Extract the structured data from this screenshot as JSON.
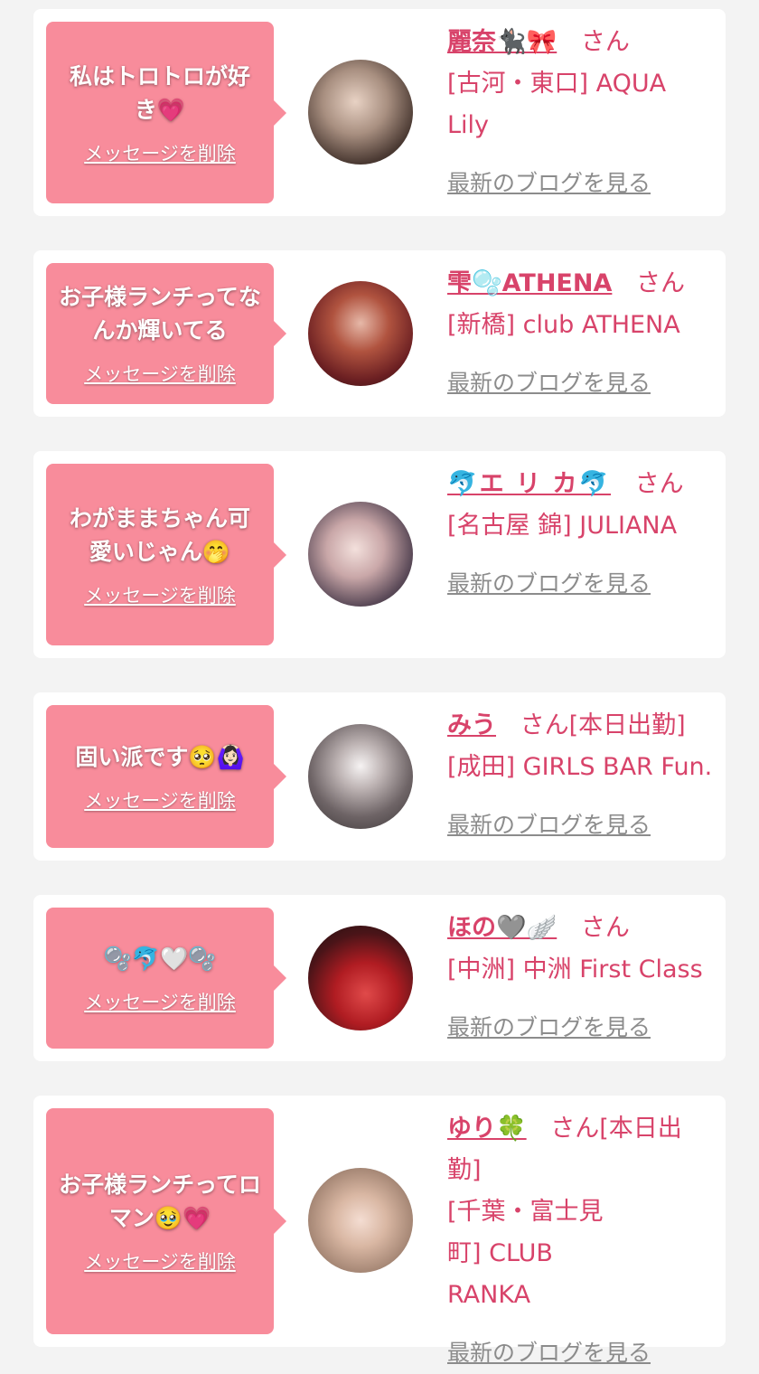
{
  "colors": {
    "page_bg": "#f3f3f3",
    "bubble_bg": "#f88c9b",
    "accent": "#d8436a",
    "muted_link": "#8c8c8c"
  },
  "cards": [
    {
      "message": "私はトロトロが好き💗",
      "delete_label": "メッセージを削除",
      "name": "麗奈🐈‍⬛🎀",
      "suffix": "さん",
      "shop": "[古河・東口] AQUA Lily",
      "blog_label": "最新のブログを見る",
      "avatar_icon": "avatar-photo"
    },
    {
      "message": "お子様ランチってなんか輝いてる",
      "delete_label": "メッセージを削除",
      "name": "雫🫧ATHENA",
      "suffix": "さん",
      "shop": "[新橋] club ATHENA",
      "blog_label": "最新のブログを見る",
      "avatar_icon": "avatar-photo"
    },
    {
      "message": "わがままちゃん可愛いじゃん🤭",
      "delete_label": "メッセージを削除",
      "name": "🐬エ リ カ🐬",
      "suffix": "さん",
      "shop": "[名古屋 錦] JULIANA",
      "blog_label": "最新のブログを見る",
      "avatar_icon": "avatar-photo"
    },
    {
      "message": "固い派です🥺🙆🏻‍♀️",
      "delete_label": "メッセージを削除",
      "name": "みう",
      "suffix": "さん[本日出勤]",
      "shop": "[成田] GIRLS BAR Fun.",
      "blog_label": "最新のブログを見る",
      "avatar_icon": "avatar-photo"
    },
    {
      "message": "🫧🐬🤍🫧",
      "delete_label": "メッセージを削除",
      "name": "ほの🩶🪽",
      "suffix": "さん",
      "shop": "[中洲] 中洲 First Class",
      "blog_label": "最新のブログを見る",
      "avatar_icon": "avatar-photo"
    },
    {
      "message": "お子様ランチってロマン🥹💗",
      "delete_label": "メッセージを削除",
      "name": "ゆり🍀",
      "suffix": "さん[本日出勤]",
      "shop": "[千葉・富士見町] CLUB RANKA",
      "blog_label": "最新のブログを見る",
      "avatar_icon": "avatar-photo"
    }
  ]
}
